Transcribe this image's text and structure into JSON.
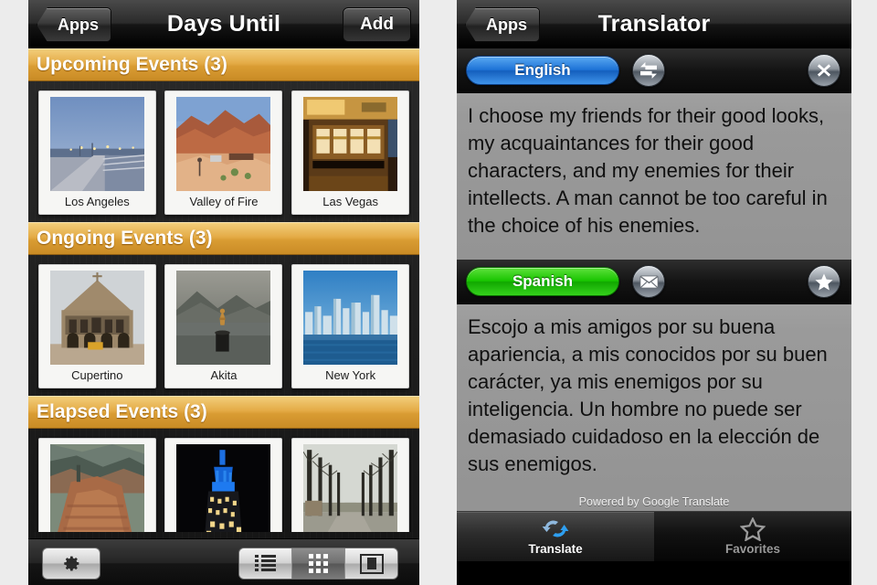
{
  "left_app": {
    "navbar": {
      "back_label": "Apps",
      "title": "Days Until",
      "add_label": "Add"
    },
    "sections": [
      {
        "header": "Upcoming Events (3)",
        "events": [
          {
            "caption": "Los Angeles",
            "image": "pier-at-dusk"
          },
          {
            "caption": "Valley of Fire",
            "image": "red-rock-desert"
          },
          {
            "caption": "Las Vegas",
            "image": "slot-machines"
          }
        ]
      },
      {
        "header": "Ongoing Events (3)",
        "events": [
          {
            "caption": "Cupertino",
            "image": "stanford-memorial-church"
          },
          {
            "caption": "Akita",
            "image": "statue-in-lake"
          },
          {
            "caption": "New York",
            "image": "manhattan-skyline"
          }
        ]
      },
      {
        "header": "Elapsed Events (3)",
        "events": [
          {
            "caption": "",
            "image": "grand-canyon"
          },
          {
            "caption": "",
            "image": "blue-lit-skyscraper"
          },
          {
            "caption": "",
            "image": "tree-lined-road"
          }
        ]
      }
    ],
    "toolbar": {
      "settings_icon": "gear-icon",
      "view_modes": [
        {
          "name": "list-view",
          "icon": "list-icon",
          "selected": false
        },
        {
          "name": "grid-view",
          "icon": "grid-icon",
          "selected": true
        },
        {
          "name": "coverflow-view",
          "icon": "coverflow-icon",
          "selected": false
        }
      ]
    }
  },
  "right_app": {
    "navbar": {
      "back_label": "Apps",
      "title": "Translator"
    },
    "source": {
      "language": "English",
      "language_color": "#1d72d6",
      "swap_icon": "swap-arrows-icon",
      "clear_icon": "close-x-icon",
      "text": "I choose my friends for their good looks, my acquaintances for their good characters, and my enemies for their intellects. A man cannot be too careful in the choice of his enemies."
    },
    "target": {
      "language": "Spanish",
      "language_color": "#18c400",
      "mail_icon": "envelope-icon",
      "favorite_icon": "star-icon",
      "text": "Escojo a mis amigos por su buena apariencia, a mis conocidos por su buen carácter, ya mis enemigos por su inteligencia. Un hombre no puede ser demasiado cuidadoso en la elección de sus enemigos."
    },
    "attribution": "Powered by Google Translate",
    "tabs": [
      {
        "label": "Translate",
        "icon": "translate-arrows-icon",
        "active": true
      },
      {
        "label": "Favorites",
        "icon": "star-icon",
        "active": false
      }
    ]
  }
}
